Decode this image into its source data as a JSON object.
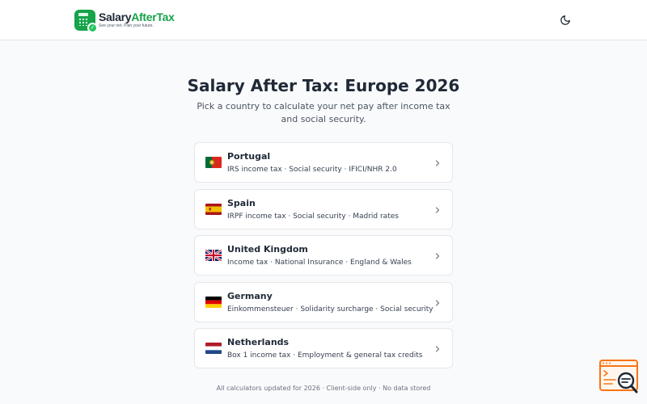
{
  "header": {
    "logo_name_part1": "Salary",
    "logo_name_part2": "AfterTax",
    "logo_tagline": "See your net. Plan your future.",
    "theme_icon": "moon-icon"
  },
  "main": {
    "title": "Salary After Tax: Europe 2026",
    "subtitle": "Pick a country to calculate your net pay after income tax and social security."
  },
  "countries": [
    {
      "name": "Portugal",
      "description": "IRS income tax · Social security · IFICI/NHR 2.0",
      "flag_icon": "portugal-flag-icon"
    },
    {
      "name": "Spain",
      "description": "IRPF income tax · Social security · Madrid rates",
      "flag_icon": "spain-flag-icon"
    },
    {
      "name": "United Kingdom",
      "description": "Income tax · National Insurance · England & Wales",
      "flag_icon": "uk-flag-icon"
    },
    {
      "name": "Germany",
      "description": "Einkommensteuer · Solidarity surcharge · Social security",
      "flag_icon": "germany-flag-icon"
    },
    {
      "name": "Netherlands",
      "description": "Box 1 income tax · Employment & general tax credits",
      "flag_icon": "netherlands-flag-icon"
    }
  ],
  "footer": {
    "text": "All calculators updated for 2026 · Client-side only · No data stored"
  },
  "colors": {
    "brand_green": "#16a34a",
    "accent_orange": "#f97316",
    "text_dark": "#1f2937",
    "background": "#f9fafb"
  }
}
